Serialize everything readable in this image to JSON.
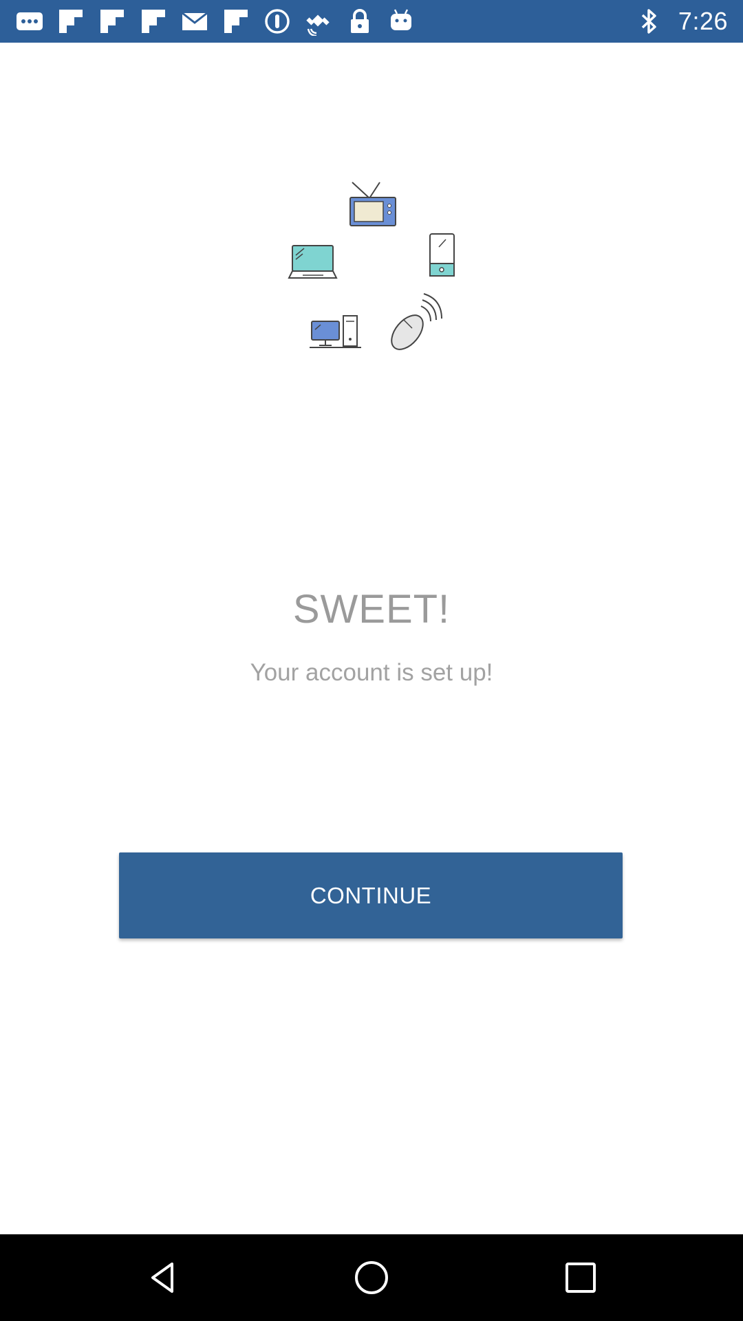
{
  "status_bar": {
    "time": "7:26",
    "left_icons": [
      "more-icon",
      "flipboard-icon",
      "flipboard-icon",
      "flipboard-icon",
      "email-icon",
      "flipboard-icon",
      "alert-icon",
      "fake-gps-icon",
      "lock-icon",
      "android-icon"
    ],
    "right_icons": [
      "bluetooth-icon"
    ],
    "colors": {
      "background": "#2d5f99",
      "foreground": "#ffffff"
    }
  },
  "illustration": {
    "icons": [
      "tv-icon",
      "laptop-icon",
      "tablet-icon",
      "desktop-computer-icon",
      "wireless-mouse-icon"
    ]
  },
  "content": {
    "title": "SWEET!",
    "subtitle": "Your account is set up!"
  },
  "button": {
    "label": "CONTINUE",
    "color": "#326396"
  },
  "nav_bar": {
    "icons": [
      "back-icon",
      "home-icon",
      "recents-icon"
    ]
  }
}
